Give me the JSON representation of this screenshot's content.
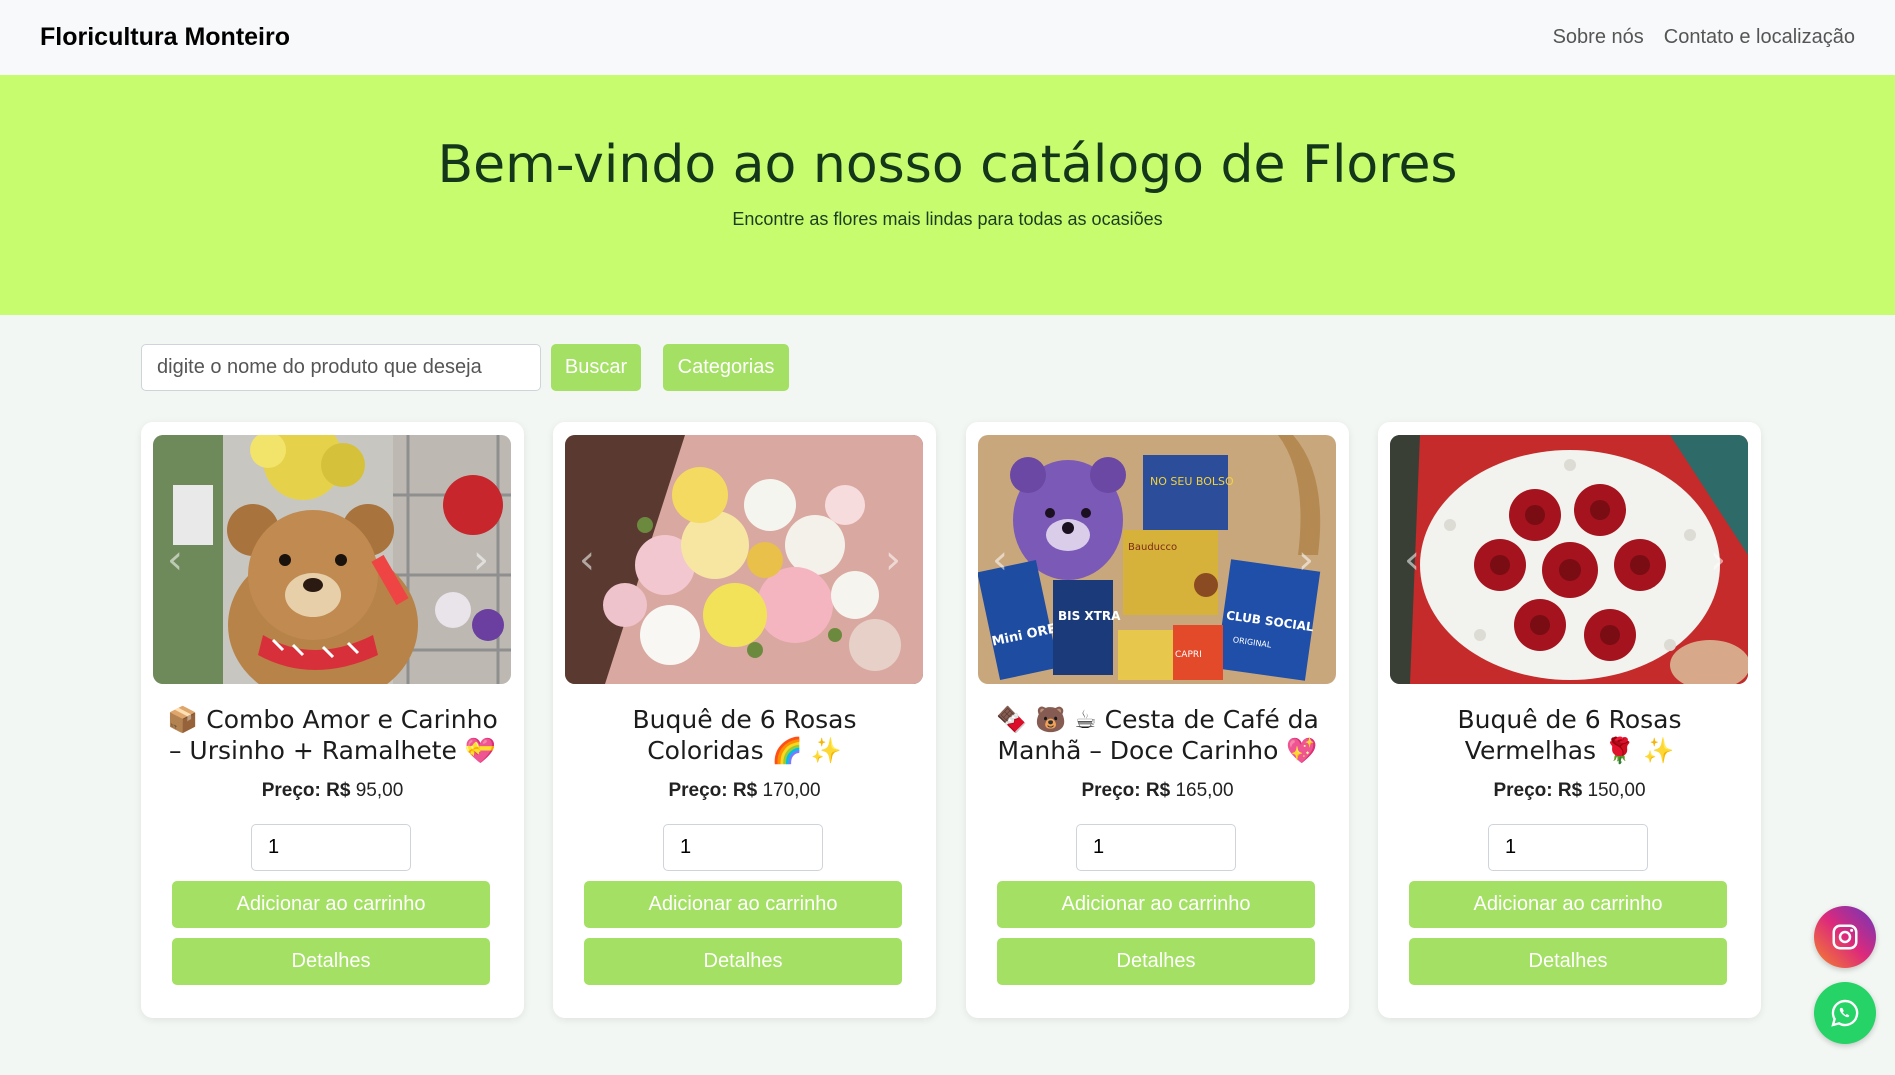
{
  "navbar": {
    "brand": "Floricultura Monteiro",
    "links": [
      "Sobre nós",
      "Contato e localização"
    ]
  },
  "hero": {
    "title": "Bem-vindo ao nosso catálogo de Flores",
    "subtitle": "Encontre as flores mais lindas para todas as ocasiões"
  },
  "search": {
    "placeholder": "digite o nome do produto que deseja",
    "button_label": "Buscar",
    "categories_label": "Categorias"
  },
  "products": [
    {
      "title": "📦 Combo Amor e Carinho – Ursinho + Ramalhete 💝",
      "price_label": "Preço:",
      "currency": "R$",
      "price": "95,00",
      "quantity": "1",
      "add_label": "Adicionar ao carrinho",
      "details_label": "Detalhes"
    },
    {
      "title": "Buquê de 6 Rosas Coloridas 🌈 ✨",
      "price_label": "Preço:",
      "currency": "R$",
      "price": "170,00",
      "quantity": "1",
      "add_label": "Adicionar ao carrinho",
      "details_label": "Detalhes"
    },
    {
      "title": "🍫 🐻 ☕ Cesta de Café da Manhã – Doce Carinho 💖",
      "price_label": "Preço:",
      "currency": "R$",
      "price": "165,00",
      "quantity": "1",
      "add_label": "Adicionar ao carrinho",
      "details_label": "Detalhes"
    },
    {
      "title": "Buquê de 6 Rosas Vermelhas 🌹 ✨",
      "price_label": "Preço:",
      "currency": "R$",
      "price": "150,00",
      "quantity": "1",
      "add_label": "Adicionar ao carrinho",
      "details_label": "Detalhes"
    }
  ],
  "product_images": [
    "BIS XTRA",
    "Mini OREO",
    "Bauducco",
    "CLUB SOCIAL",
    "CAPRI",
    "ORIGINAL",
    "NO SEU BOLSO"
  ],
  "floating": {
    "instagram_icon": "instagram-icon",
    "whatsapp_icon": "whatsapp-icon"
  },
  "colors": {
    "hero_bg": "#c6fc6e",
    "button_bg": "#a3e063",
    "page_bg": "#f3f7f3"
  }
}
